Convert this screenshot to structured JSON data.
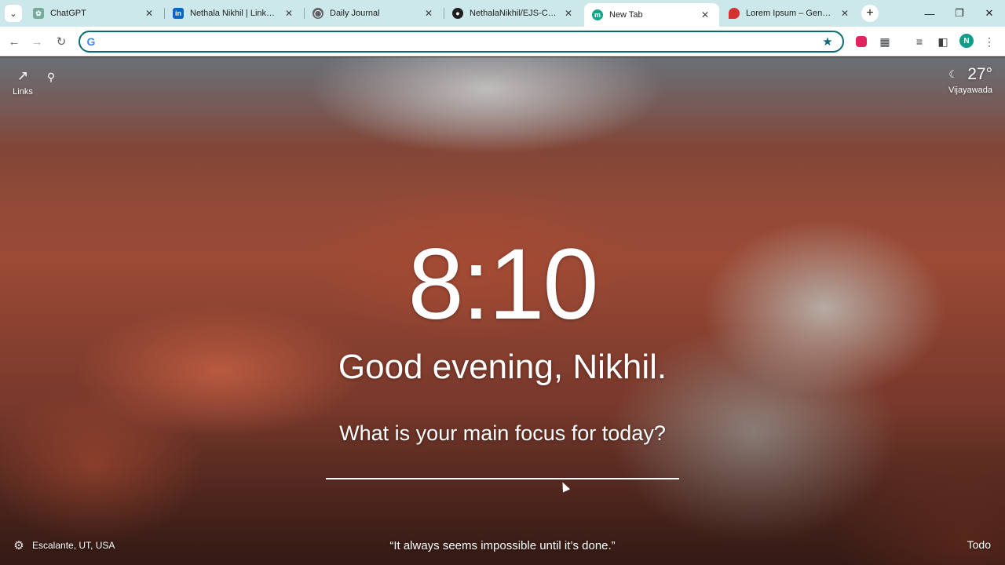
{
  "browser": {
    "tab_search_icon": "chevron-down-icon",
    "tabs": [
      {
        "title": "ChatGPT",
        "favicon": "chatgpt-icon",
        "favicon_color": "#74aa9c"
      },
      {
        "title": "Nethala Nikhil | LinkedIn",
        "favicon": "linkedin-icon",
        "favicon_color": "#0a66c2"
      },
      {
        "title": "Daily Journal",
        "favicon": "globe-icon",
        "favicon_color": "#5f6368"
      },
      {
        "title": "NethalaNikhil/EJS-Challeng",
        "favicon": "github-icon",
        "favicon_color": "#1f1f1f"
      },
      {
        "title": "New Tab",
        "favicon": "momentum-icon",
        "favicon_color": "#17a589",
        "active": true
      },
      {
        "title": "Lorem Ipsum – Generator",
        "favicon": "lorem-icon",
        "favicon_color": "#d63031"
      }
    ],
    "toolbar": {
      "address_value": "",
      "address_placeholder": ""
    },
    "profile_initial": "N",
    "accent_color": "#0b6c74"
  },
  "momentum": {
    "links_label": "Links",
    "weather": {
      "temperature": "27°",
      "city": "Vijayawada"
    },
    "clock": "8:10",
    "greeting": "Good evening, Nikhil.",
    "focus_question": "What is your main focus for today?",
    "focus_value": "",
    "photo_location": "Escalante, UT, USA",
    "quote": "“It always seems impossible until it’s done.”",
    "todo_label": "Todo"
  }
}
